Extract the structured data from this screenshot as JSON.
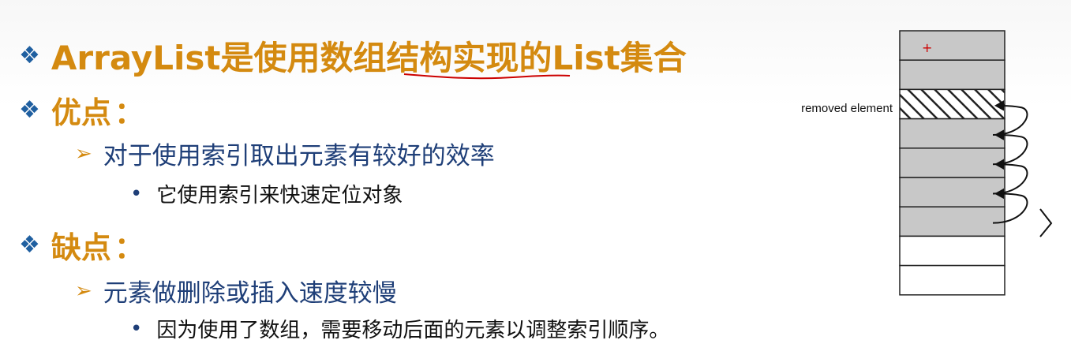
{
  "title": "ArrayList是使用数组结构实现的List集合",
  "advantages": {
    "heading": "优点",
    "point": "对于使用索引取出元素有较好的效率",
    "detail": "它使用索引来快速定位对象"
  },
  "disadvantages": {
    "heading": "缺点",
    "point": "元素做删除或插入速度较慢",
    "detail": "因为使用了数组，需要移动后面的元素以调整索引顺序。"
  },
  "diagram": {
    "removed_label": "removed element",
    "filled_cells": 7,
    "total_cells": 9,
    "removed_index": 2,
    "colors": {
      "filled": "#c8c8c8",
      "empty": "#ffffff",
      "stroke": "#222222",
      "accent": "#d48a10",
      "text_blue": "#1f3f78",
      "diamond": "#1f5fa0",
      "annotation": "#cc0000"
    }
  }
}
